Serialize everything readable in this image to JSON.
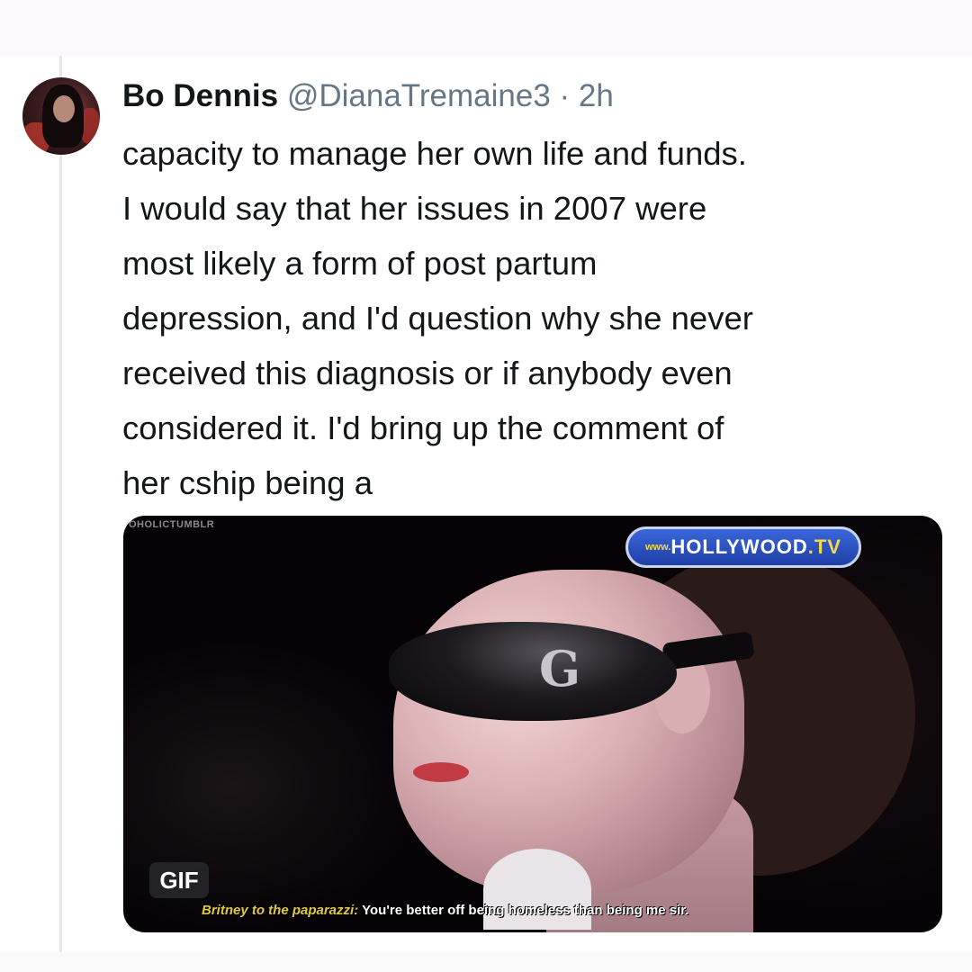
{
  "tweet": {
    "author_name": "Bo Dennis",
    "author_handle": "@DianaTremaine3",
    "separator": " · ",
    "timestamp": "2h",
    "text_lines": [
      "capacity to manage her own life and funds.",
      "I would say that her issues in 2007 were",
      "most likely a form of post partum",
      "depression, and I'd question why she never",
      "received this diagnosis or if anybody even",
      "considered it. I'd bring up the comment of",
      "her cship being a"
    ]
  },
  "media": {
    "type_badge": "GIF",
    "watermark": "OHOLICTUMBLR",
    "channel_logo_prefix": "www.",
    "channel_logo_main": "HOLLYWOOD",
    "channel_logo_tld": ".TV",
    "glasses_logo": "G",
    "subtitle_speaker": "Britney to the paparazzi:",
    "subtitle_quote": "You're better off being homeless than being me sir."
  },
  "colors": {
    "name": "#14171a",
    "secondary": "#657786",
    "channel_blue": "#2a52c4"
  },
  "icons": {
    "avatar": "profile-photo"
  }
}
